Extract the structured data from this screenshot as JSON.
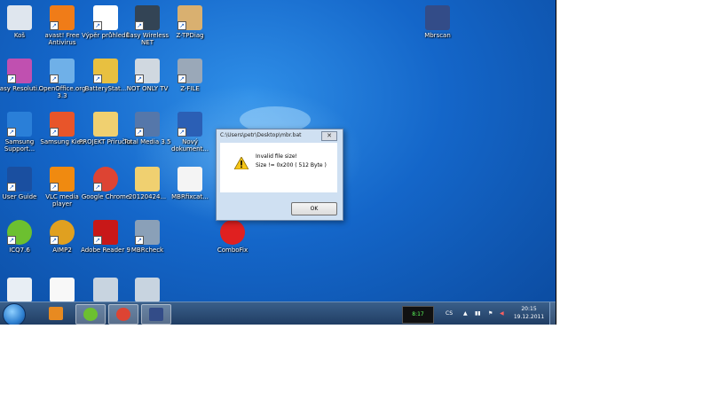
{
  "desktop": {
    "icons": [
      {
        "label": "Koš",
        "icon": "recycle-bin-icon",
        "color": "#dfe6ee",
        "shortcut": false
      },
      {
        "label": "avast! Free Antivirus",
        "icon": "avast-icon",
        "color": "#f07c18",
        "shortcut": true
      },
      {
        "label": "Výpěr průhledů",
        "icon": "document-list-icon",
        "color": "#ffffff",
        "shortcut": true
      },
      {
        "label": "Easy Wireless NET",
        "icon": "wireless-icon",
        "color": "#334455",
        "shortcut": true
      },
      {
        "label": "Z-TPDiag",
        "icon": "diag-tool-icon",
        "color": "#d9b070",
        "shortcut": true
      },
      {
        "label": "Easy Resoluti...",
        "icon": "display-settings-icon",
        "color": "#c050b0",
        "shortcut": true
      },
      {
        "label": "OpenOffice.org 3.3",
        "icon": "openoffice-icon",
        "color": "#6fb0e8",
        "shortcut": true
      },
      {
        "label": "BatteryStat...",
        "icon": "battery-icon",
        "color": "#e8c040",
        "shortcut": true
      },
      {
        "label": "NOT ONLY TV",
        "icon": "tv-icon",
        "color": "#d0d8e0",
        "shortcut": true
      },
      {
        "label": "Z-FILE",
        "icon": "file-tool-icon",
        "color": "#9aa8b8",
        "shortcut": true
      },
      {
        "label": "Samsung Support...",
        "icon": "samsung-globe-icon",
        "color": "#2a7fd8",
        "shortcut": true
      },
      {
        "label": "Samsung Kies",
        "icon": "kies-icon",
        "color": "#e8552a",
        "shortcut": true
      },
      {
        "label": "PROJEKT Příručka",
        "icon": "folder-icon",
        "color": "#f0d070",
        "shortcut": false
      },
      {
        "label": "Total Media 3.5",
        "icon": "total-media-icon",
        "color": "#5577aa",
        "shortcut": true
      },
      {
        "label": "Nový dokument...",
        "icon": "word-document-icon",
        "color": "#2b5fb5",
        "shortcut": true
      },
      {
        "label": "User Guide",
        "icon": "user-guide-icon",
        "color": "#1a4fa0",
        "shortcut": true
      },
      {
        "label": "VLC media player",
        "icon": "vlc-icon",
        "color": "#f08a10",
        "shortcut": true
      },
      {
        "label": "Google Chrome",
        "icon": "chrome-icon",
        "color": "#dd4433",
        "shortcut": true
      },
      {
        "label": "20120424...",
        "icon": "folder-icon",
        "color": "#f0d070",
        "shortcut": false
      },
      {
        "label": "MBRfixcat...",
        "icon": "text-file-icon",
        "color": "#f4f4f4",
        "shortcut": false
      },
      {
        "label": "ICQ7.6",
        "icon": "icq-flower-icon",
        "color": "#6cc030",
        "shortcut": true
      },
      {
        "label": "AIMP2",
        "icon": "aimp-icon",
        "color": "#e0a020",
        "shortcut": true
      },
      {
        "label": "Adobe Reader 9",
        "icon": "adobe-reader-icon",
        "color": "#c81818",
        "shortcut": true
      },
      {
        "label": "MBRcheck",
        "icon": "mbrcheck-icon",
        "color": "#8aa0b8",
        "shortcut": true
      },
      {
        "label": "ComboFix",
        "icon": "combofix-icon",
        "color": "#e02020",
        "shortcut": false
      },
      {
        "label": "Mbrscan",
        "icon": "mbrscan-icon",
        "color": "#334c88",
        "shortcut": false
      },
      {
        "label": "",
        "icon": "settings-file-icon",
        "color": "#e8eef4",
        "shortcut": false
      },
      {
        "label": "",
        "icon": "blank-file-icon",
        "color": "#f8f8f8",
        "shortcut": false
      },
      {
        "label": "",
        "icon": "gear-config-icon",
        "color": "#c8d4e0",
        "shortcut": false
      },
      {
        "label": "",
        "icon": "gear-config-icon",
        "color": "#c8d4e0",
        "shortcut": false
      }
    ]
  },
  "dialog": {
    "title": "C:\\Users\\petr\\Desktop\\mbr.bat",
    "close_label": "✕",
    "message_line1": "Invalid file size!",
    "message_line2": "Size != 0x200 ( 512 Byte )",
    "ok_label": "OK"
  },
  "taskbar": {
    "pinned": [
      {
        "icon": "media-player-icon",
        "color": "#e88a20",
        "active": false
      },
      {
        "icon": "icq-flower-icon",
        "color": "#6cc030",
        "active": true
      },
      {
        "icon": "chrome-icon",
        "color": "#dd4433",
        "active": true
      },
      {
        "icon": "mbrscan-icon",
        "color": "#334c88",
        "active": true
      }
    ],
    "tray_app_label": "8:17",
    "language": "CS",
    "clock_time": "20:15",
    "clock_date": "19.12.2011"
  }
}
